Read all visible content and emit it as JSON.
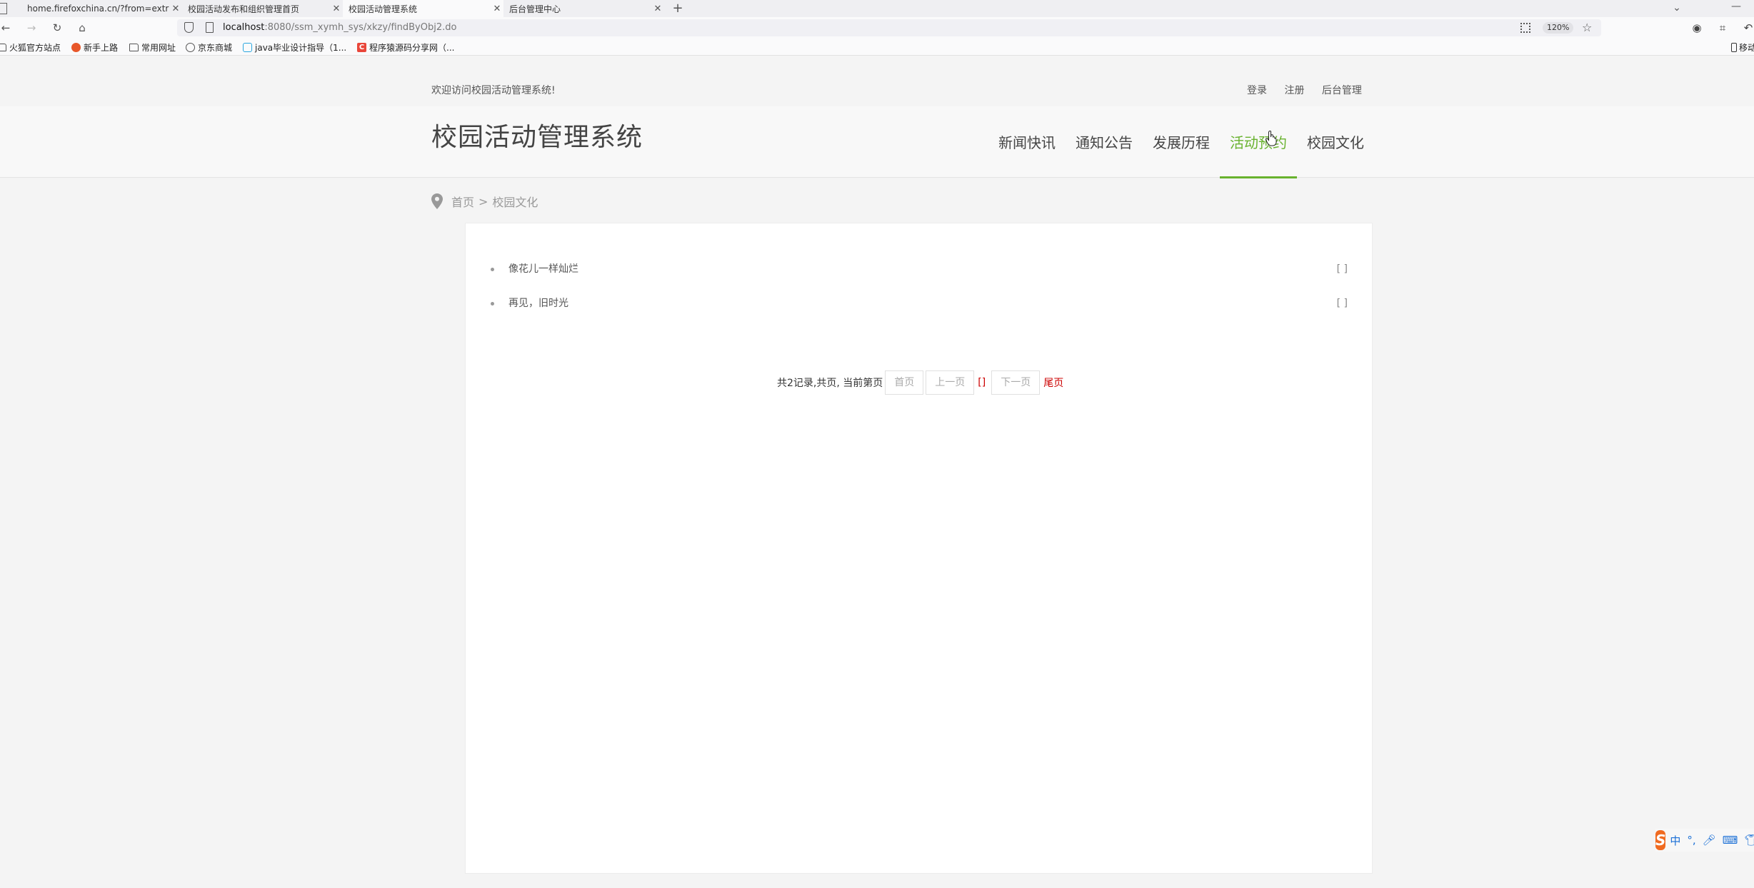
{
  "browser": {
    "tabs": [
      {
        "label": "home.firefoxchina.cn/?from=extra_start",
        "active": false
      },
      {
        "label": "校园活动发布和组织管理首页",
        "active": false
      },
      {
        "label": "校园活动管理系统",
        "active": true
      },
      {
        "label": "后台管理中心",
        "active": false
      }
    ],
    "url_host": "localhost",
    "url_path": ":8080/ssm_xymh_sys/xkzy/findByObj2.do",
    "zoom": "120%",
    "bookmarks": [
      "火狐官方站点",
      "新手上路",
      "常用网址",
      "京东商城",
      "java毕业设计指导（1...",
      "程序猿源码分享网（..."
    ],
    "bookmarks_mobile": "移动"
  },
  "page": {
    "welcome": "欢迎访问校园活动管理系统!",
    "top_links": {
      "login": "登录",
      "register": "注册",
      "admin": "后台管理"
    },
    "site_title": "校园活动管理系统",
    "nav": [
      "新闻快讯",
      "通知公告",
      "发展历程",
      "活动预约",
      "校园文化"
    ],
    "active_nav": "活动预约",
    "breadcrumb": {
      "home": "首页",
      "separator": ">",
      "current": "校园文化"
    },
    "items": [
      {
        "title": "像花儿一样灿烂",
        "date": "[ ]"
      },
      {
        "title": "再见，旧时光",
        "date": "[ ]"
      }
    ],
    "pagination": {
      "summary": "共2记录,共页, 当前第页",
      "first": "首页",
      "prev": "上一页",
      "current": "[]",
      "next": "下一页",
      "last": "尾页"
    }
  },
  "ime": {
    "lang": "中"
  },
  "colors": {
    "accent": "#68b22e",
    "pager_active": "#cc0000"
  }
}
